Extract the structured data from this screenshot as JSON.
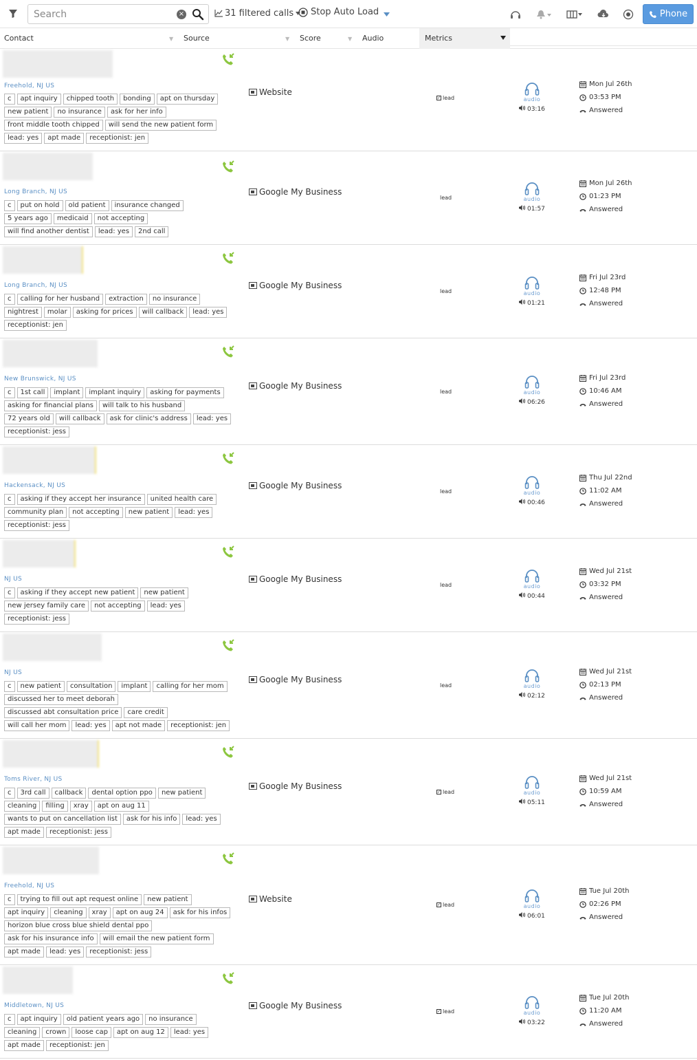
{
  "toolbar": {
    "search_placeholder": "Search",
    "filtered_calls": "31 filtered calls",
    "stop_auto_load": "Stop Auto Load",
    "phone_label": "Phone"
  },
  "columns": {
    "contact": "Contact",
    "source": "Source",
    "score": "Score",
    "audio": "Audio",
    "metrics": "Metrics"
  },
  "rows": [
    {
      "location": "Freehold, NJ US",
      "tags": [
        [
          "c",
          "apt inquiry",
          "chipped tooth",
          "bonding",
          "apt on thursday"
        ],
        [
          "new patient",
          "no insurance",
          "ask for her info"
        ],
        [
          "front middle tooth chipped",
          "will send the new patient form"
        ],
        [
          "lead: yes",
          "apt made",
          "receptionist: jen"
        ]
      ],
      "source": "Website",
      "lead": "lead",
      "audio_label": "audio",
      "duration": "03:16",
      "date": "Mon Jul 26th",
      "time": "03:53 PM",
      "status": "Answered"
    },
    {
      "location": "Long Branch, NJ US",
      "tags": [
        [
          "c",
          "put on hold",
          "old patient",
          "insurance changed"
        ],
        [
          "5 years ago",
          "medicaid",
          "not accepting"
        ],
        [
          "will find another dentist",
          "lead: yes",
          "2nd call"
        ]
      ],
      "source": "Google My Business",
      "lead": "lead",
      "audio_label": "audio",
      "duration": "01:57",
      "date": "Mon Jul 26th",
      "time": "01:23 PM",
      "status": "Answered"
    },
    {
      "location": "Long Branch, NJ US",
      "tags": [
        [
          "c",
          "calling for her husband",
          "extraction",
          "no insurance"
        ],
        [
          "nightrest",
          "molar",
          "asking for prices",
          "will callback",
          "lead: yes"
        ],
        [
          "receptionist: jen"
        ]
      ],
      "source": "Google My Business",
      "lead": "lead",
      "audio_label": "audio",
      "duration": "01:21",
      "date": "Fri Jul 23rd",
      "time": "12:48 PM",
      "status": "Answered"
    },
    {
      "location": "New Brunswick, NJ US",
      "tags": [
        [
          "c",
          "1st call",
          "implant",
          "implant inquiry",
          "asking for payments"
        ],
        [
          "asking for financial plans",
          "will talk to his husband"
        ],
        [
          "72 years old",
          "will callback",
          "ask for clinic's address",
          "lead: yes"
        ],
        [
          "receptionist: jess"
        ]
      ],
      "source": "Google My Business",
      "lead": "lead",
      "audio_label": "audio",
      "duration": "06:26",
      "date": "Fri Jul 23rd",
      "time": "10:46 AM",
      "status": "Answered"
    },
    {
      "location": "Hackensack, NJ US",
      "tags": [
        [
          "c",
          "asking if they accept her insurance",
          "united health care"
        ],
        [
          "community plan",
          "not accepting",
          "new patient",
          "lead: yes"
        ],
        [
          "receptionist: jess"
        ]
      ],
      "source": "Google My Business",
      "lead": "lead",
      "audio_label": "audio",
      "duration": "00:46",
      "date": "Thu Jul 22nd",
      "time": "11:02 AM",
      "status": "Answered"
    },
    {
      "location": "NJ US",
      "tags": [
        [
          "c",
          "asking if they accept new patient",
          "new patient"
        ],
        [
          "new jersey family care",
          "not accepting",
          "lead: yes"
        ],
        [
          "receptionist: jess"
        ]
      ],
      "source": "Google My Business",
      "lead": "lead",
      "audio_label": "audio",
      "duration": "00:44",
      "date": "Wed Jul 21st",
      "time": "03:32 PM",
      "status": "Answered"
    },
    {
      "location": "NJ US",
      "tags": [
        [
          "c",
          "new patient",
          "consultation",
          "implant",
          "calling for her mom"
        ],
        [
          "discussed her to meet deborah"
        ],
        [
          "discussed abt consultation price",
          "care credit"
        ],
        [
          "will call her mom",
          "lead: yes",
          "apt not made",
          "receptionist: jen"
        ]
      ],
      "source": "Google My Business",
      "lead": "lead",
      "audio_label": "audio",
      "duration": "02:12",
      "date": "Wed Jul 21st",
      "time": "02:13 PM",
      "status": "Answered"
    },
    {
      "location": "Toms River, NJ US",
      "tags": [
        [
          "c",
          "3rd call",
          "callback",
          "dental option ppo",
          "new patient"
        ],
        [
          "cleaning",
          "filling",
          "xray",
          "apt on aug 11"
        ],
        [
          "wants to put on cancellation list",
          "ask for his info",
          "lead: yes"
        ],
        [
          "apt made",
          "receptionist: jess"
        ]
      ],
      "source": "Google My Business",
      "lead": "lead",
      "audio_label": "audio",
      "duration": "05:11",
      "date": "Wed Jul 21st",
      "time": "10:59 AM",
      "status": "Answered"
    },
    {
      "location": "Freehold, NJ US",
      "tags": [
        [
          "c",
          "trying to fill out apt request online",
          "new patient"
        ],
        [
          "apt inquiry",
          "cleaning",
          "xray",
          "apt on aug 24",
          "ask for his infos"
        ],
        [
          "horizon blue cross blue shield dental ppo"
        ],
        [
          "ask for his insurance info",
          "will email the new patient form"
        ],
        [
          "apt made",
          "lead: yes",
          "receptionist: jess"
        ]
      ],
      "source": "Website",
      "lead": "lead",
      "audio_label": "audio",
      "duration": "06:01",
      "date": "Tue Jul 20th",
      "time": "02:26 PM",
      "status": "Answered"
    },
    {
      "location": "Middletown, NJ US",
      "tags": [
        [
          "c",
          "apt inquiry",
          "old patient years ago",
          "no insurance"
        ],
        [
          "cleaning",
          "crown",
          "loose cap",
          "apt on aug 12",
          "lead: yes"
        ],
        [
          "apt made",
          "receptionist: jen"
        ]
      ],
      "source": "Google My Business",
      "lead": "lead",
      "audio_label": "audio",
      "duration": "03:22",
      "date": "Tue Jul 20th",
      "time": "11:20 AM",
      "status": "Answered"
    }
  ]
}
